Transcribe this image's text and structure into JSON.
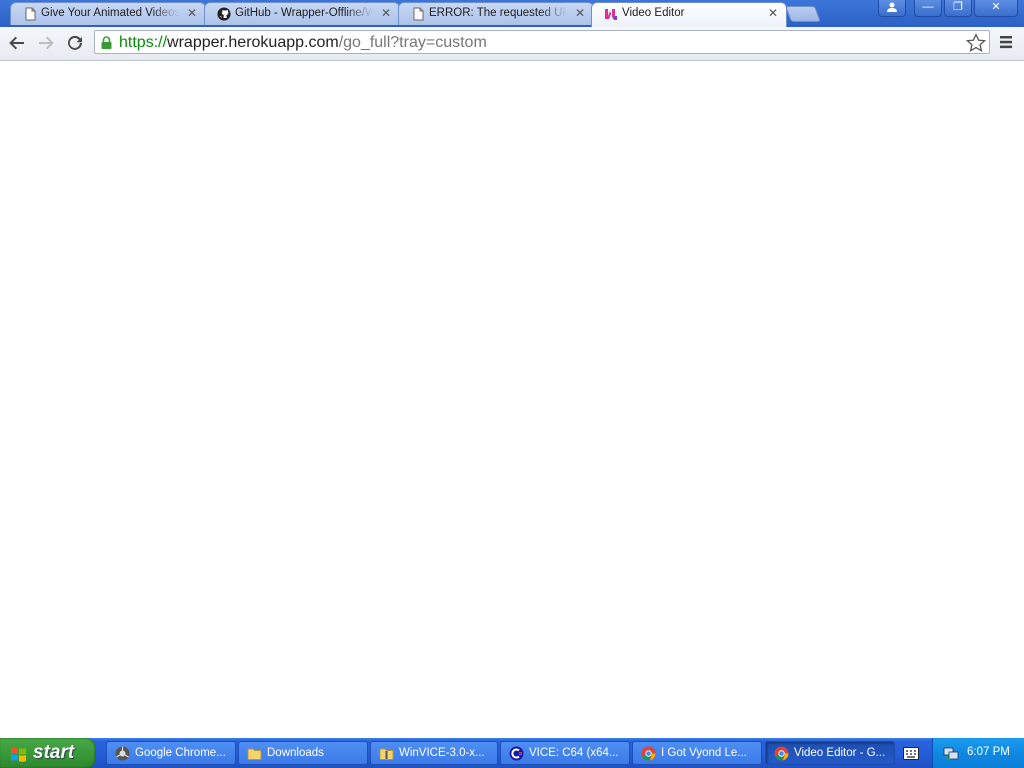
{
  "browser": {
    "tabs": [
      {
        "title": "Give Your Animated Videos th",
        "icon": "page-icon",
        "active": false
      },
      {
        "title": "GitHub - Wrapper-Offline/Wr",
        "icon": "github-icon",
        "active": false
      },
      {
        "title": "ERROR: The requested URL",
        "icon": "page-icon",
        "active": false
      },
      {
        "title": "Video Editor",
        "icon": "wrapper-logo-icon",
        "active": true
      }
    ],
    "close_glyph": "✕",
    "address": {
      "scheme": "https://",
      "host": "wrapper.herokuapp.com",
      "path": "/go_full?tray=custom"
    },
    "window_buttons": {
      "minimize": "—",
      "restore": "❐",
      "close": "✕"
    }
  },
  "taskbar": {
    "start_label": "start",
    "tasks": [
      {
        "label": "Google Chrome...",
        "icon": "chrome-dev-icon",
        "active": false
      },
      {
        "label": "Downloads",
        "icon": "folder-icon",
        "active": false
      },
      {
        "label": "WinVICE-3.0-x...",
        "icon": "zip-folder-icon",
        "active": false
      },
      {
        "label": "VICE: C64 (x64...",
        "icon": "vice-icon",
        "active": false
      },
      {
        "label": "I Got Vyond Le...",
        "icon": "chrome-icon",
        "active": false
      },
      {
        "label": "Video Editor - G...",
        "icon": "chrome-icon",
        "active": true
      }
    ],
    "clock": "6:07 PM"
  },
  "colors": {
    "url_scheme": "#0a8a0a",
    "titlebar": "#2c60c5",
    "taskbar": "#245edb",
    "start_button": "#3a9a3a",
    "tray": "#0f89e2"
  }
}
